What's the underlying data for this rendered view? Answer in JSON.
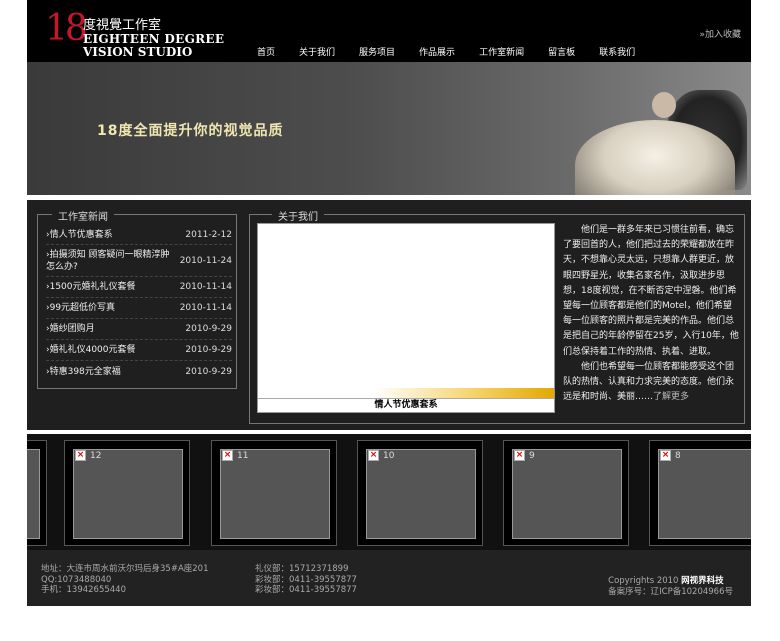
{
  "header": {
    "logo_number": "18",
    "logo_cn": "度視覺工作室",
    "logo_en_line1": "EIGHTEEN DEGREE",
    "logo_en_line2": "VISION STUDIO",
    "favorite": "»加入收藏",
    "nav": [
      "首页",
      "关于我们",
      "服务项目",
      "作品展示",
      "工作室新闻",
      "留言板",
      "联系我们"
    ]
  },
  "banner": {
    "slogan": "18度全面提升你的视觉品质"
  },
  "news": {
    "title": "工作室新闻",
    "items": [
      {
        "title": "›情人节优惠套系",
        "date": "2011-2-12"
      },
      {
        "title": "›拍摄须知 顾客疑问一眼精淳肿怎么办?",
        "date": "2010-11-24"
      },
      {
        "title": "›1500元婚礼礼仪套餐",
        "date": "2010-11-14"
      },
      {
        "title": "›99元超低价写真",
        "date": "2010-11-14"
      },
      {
        "title": "›婚纱团购月",
        "date": "2010-9-29"
      },
      {
        "title": "›婚礼礼仪4000元套餐",
        "date": "2010-9-29"
      },
      {
        "title": "›特惠398元全家福",
        "date": "2010-9-29"
      }
    ]
  },
  "about": {
    "title": "关于我们",
    "photo_caption": "情人节优惠套系",
    "para1": "他们是一群多年来已习惯往前看，确忘了要回首的人，他们把过去的荣耀都放在昨天，不想靠心灵太远，只想靠人群更近，放眼四野星光，收集名家名作，汲取进步思想，18度视觉，在不断否定中涅磐。他们希望每一位顾客都是他们的Motel，他们希望每一位顾客的照片都是完美的作品。他们总是把自己的年龄停留在25岁，入行10年，他们总保持着工作的热情、执着、进取。",
    "para2": "他们也希望每一位顾客都能感受这个团队的热情、认真和力求完美的态度。他们永远是和时尚、美丽……",
    "more": "了解更多"
  },
  "thumbs": [
    {
      "label": ""
    },
    {
      "label": "12"
    },
    {
      "label": "11"
    },
    {
      "label": "10"
    },
    {
      "label": "9"
    },
    {
      "label": "8"
    }
  ],
  "footer": {
    "address": "地址：大连市周水前沃尔玛后身35#A座201",
    "qq": "QQ:1073488040",
    "mobile": "手机：13942655440",
    "dept1": "礼仪部：15712371899",
    "dept2": "彩妆部：0411-39557877",
    "dept3": "彩妆部：0411-39557877",
    "copyright_prefix": "Copyrights 2010 ",
    "copyright_company": "网视界科技",
    "icp": "备案序号：辽ICP备10204966号"
  },
  "colors": {
    "logo_red": "#c6162d",
    "slogan": "#f0e6b0",
    "caption_gold": "#e3a800"
  }
}
